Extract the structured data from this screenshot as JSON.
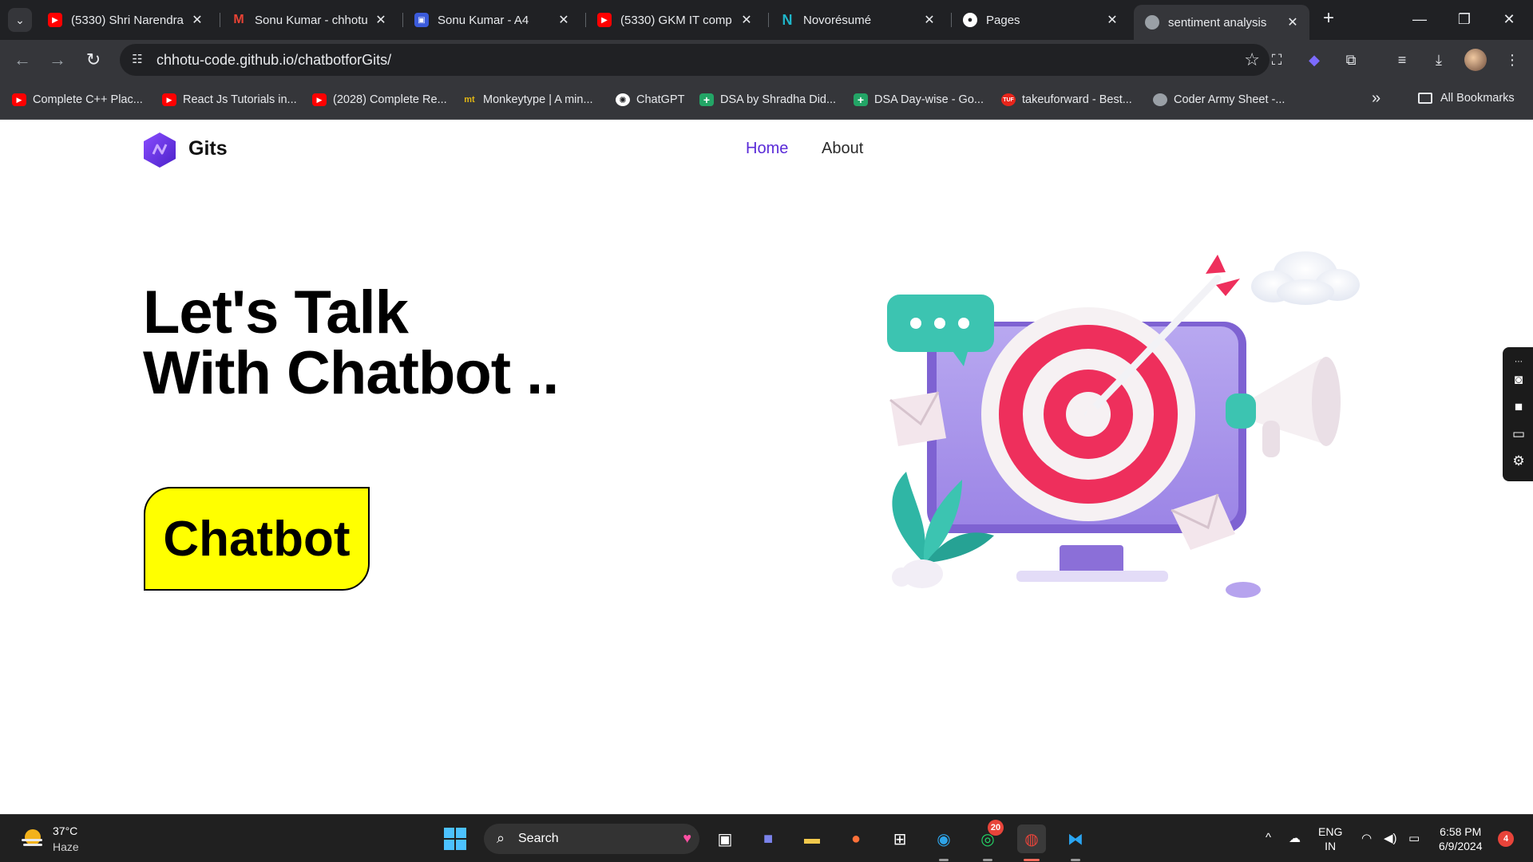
{
  "tabs": [
    {
      "title": "(5330) Shri Narendra",
      "favicon": "youtube-icon",
      "active": false
    },
    {
      "title": "Sonu Kumar - chhotu",
      "favicon": "gmail-icon",
      "active": false
    },
    {
      "title": "Sonu Kumar - A4",
      "favicon": "resume-app-icon",
      "active": false
    },
    {
      "title": "(5330) GKM IT comp",
      "favicon": "youtube-icon",
      "active": false
    },
    {
      "title": "Novorésumé",
      "favicon": "novoresume-icon",
      "active": false
    },
    {
      "title": "Pages",
      "favicon": "github-icon",
      "active": false
    },
    {
      "title": "sentiment analysis",
      "favicon": "globe-icon",
      "active": true
    }
  ],
  "address_bar": {
    "url": "chhotu-code.github.io/chatbotforGits/"
  },
  "bookmarks": [
    {
      "label": "Complete C++ Plac...",
      "icon": "youtube-icon"
    },
    {
      "label": "React Js Tutorials in...",
      "icon": "youtube-icon"
    },
    {
      "label": "(2028) Complete Re...",
      "icon": "youtube-icon"
    },
    {
      "label": "Monkeytype | A min...",
      "icon": "monkeytype-icon"
    },
    {
      "label": "ChatGPT",
      "icon": "chatgpt-icon"
    },
    {
      "label": "DSA by Shradha Did...",
      "icon": "sheets-icon"
    },
    {
      "label": "DSA Day-wise - Go...",
      "icon": "sheets-icon"
    },
    {
      "label": "takeuforward - Best...",
      "icon": "tuf-icon"
    },
    {
      "label": "Coder Army Sheet -...",
      "icon": "globe-icon"
    }
  ],
  "bookmarks_all": "All Bookmarks",
  "site": {
    "brand": "Gits",
    "nav": [
      {
        "label": "Home",
        "active": true
      },
      {
        "label": "About",
        "active": false
      }
    ],
    "hero_line1": "Let's Talk",
    "hero_line2": "With Chatbot ..",
    "cta_label": "Chatbot",
    "accent_color": "#5a2bd8",
    "cta_color": "#ffff00"
  },
  "taskbar": {
    "weather_temp": "37°C",
    "weather_desc": "Haze",
    "search_label": "Search",
    "whatsapp_badge": "20",
    "lang_line1": "ENG",
    "lang_line2": "IN",
    "time": "6:58 PM",
    "date": "6/9/2024",
    "notification_count": "4"
  }
}
